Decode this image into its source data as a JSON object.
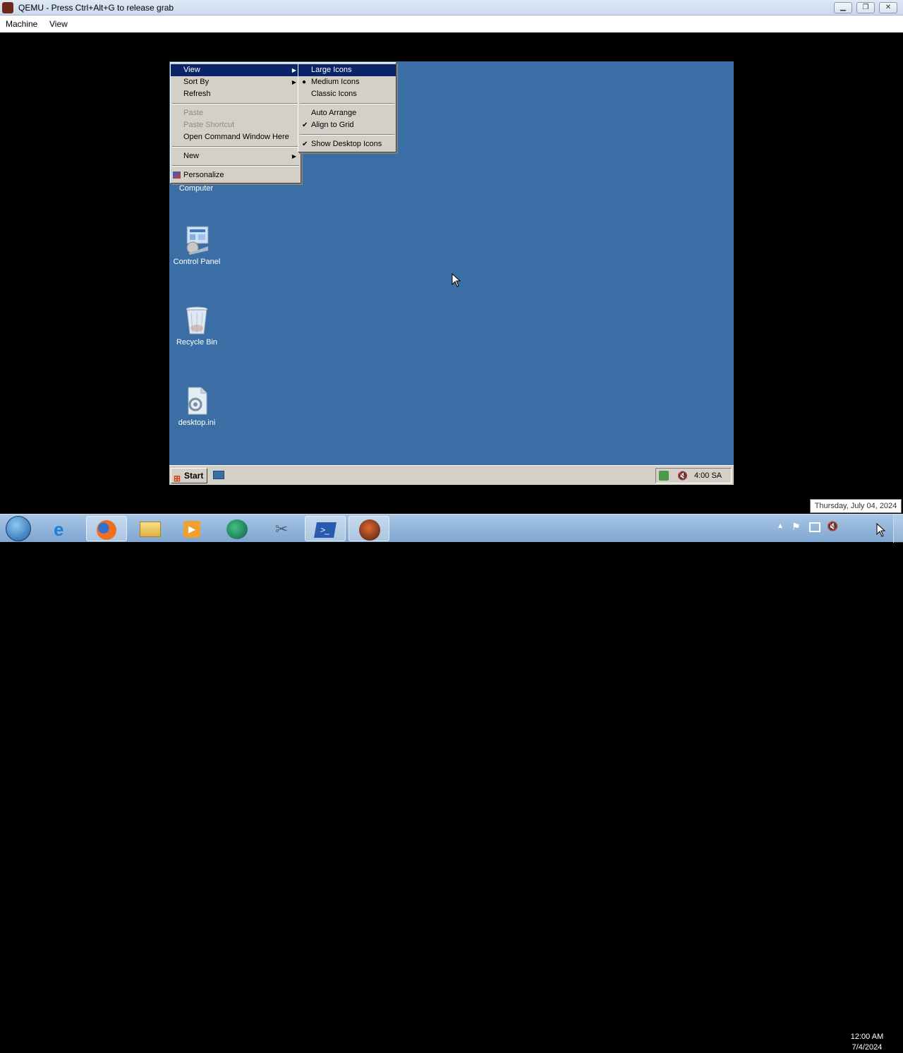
{
  "host": {
    "title": "QEMU - Press Ctrl+Alt+G to release grab",
    "menu": [
      "Machine",
      "View"
    ],
    "window_buttons": [
      "minimize",
      "restore",
      "close"
    ]
  },
  "desktop_icons": [
    {
      "label": "Computer",
      "icon": "computer-icon"
    },
    {
      "label": "Control Panel",
      "icon": "control-panel-icon"
    },
    {
      "label": "Recycle Bin",
      "icon": "recycle-bin-icon"
    },
    {
      "label": "desktop.ini",
      "icon": "settings-file-icon"
    }
  ],
  "context_menu": {
    "items": [
      {
        "label": "View",
        "submenu": true,
        "selected": true
      },
      {
        "label": "Sort By",
        "submenu": true
      },
      {
        "label": "Refresh"
      },
      {
        "sep": true
      },
      {
        "label": "Paste",
        "disabled": true
      },
      {
        "label": "Paste Shortcut",
        "disabled": true
      },
      {
        "label": "Open Command Window Here"
      },
      {
        "sep": true
      },
      {
        "label": "New",
        "submenu": true
      },
      {
        "sep": true
      },
      {
        "label": "Personalize",
        "icon": "personalize-icon"
      }
    ]
  },
  "view_submenu": {
    "items": [
      {
        "label": "Large Icons",
        "selected": true
      },
      {
        "label": "Medium Icons",
        "mark": "bullet"
      },
      {
        "label": "Classic Icons"
      },
      {
        "sep": true
      },
      {
        "label": "Auto Arrange"
      },
      {
        "label": "Align to Grid",
        "mark": "check"
      },
      {
        "sep": true
      },
      {
        "label": "Show Desktop Icons",
        "mark": "check"
      }
    ]
  },
  "guest_taskbar": {
    "start_label": "Start",
    "clock": "4:00 SA"
  },
  "host_taskbar": {
    "apps": [
      "start-orb-icon",
      "internet-explorer-icon",
      "firefox-icon",
      "explorer-folder-icon",
      "media-player-icon",
      "browser-globe-icon",
      "tools-icon",
      "powershell-icon",
      "qemu-icon"
    ],
    "tooltip": "Thursday, July 04, 2024",
    "time": "12:00 AM",
    "date": "7/4/2024"
  }
}
